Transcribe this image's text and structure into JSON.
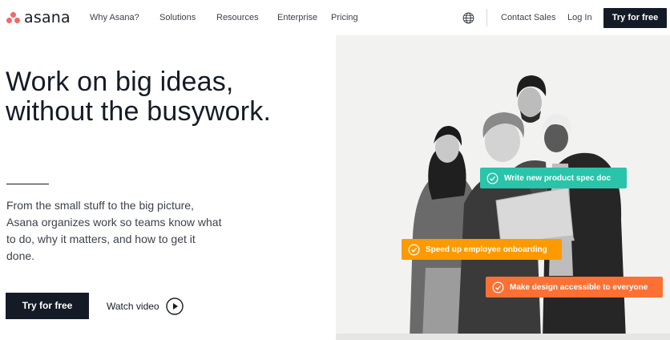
{
  "brand": {
    "name": "asana",
    "logo_color": "#f06a6a"
  },
  "nav": {
    "links": [
      "Why Asana?",
      "Solutions",
      "Resources",
      "Enterprise",
      "Pricing"
    ],
    "globe_icon": "globe-icon",
    "contact_sales": "Contact Sales",
    "log_in": "Log In",
    "cta": "Try for free"
  },
  "hero": {
    "headline_line1": "Work on big ideas,",
    "headline_line2": "without the busywork.",
    "description": "From the small stuff to the big picture, Asana organizes work so teams know what to do, why it matters, and how to get it done.",
    "primary_button": "Try for free",
    "watch_video": "Watch video",
    "play_icon": "play-icon"
  },
  "tasks": [
    {
      "label": "Write new product spec doc",
      "color": "#29c4a9",
      "icon": "check-circle-icon"
    },
    {
      "label": "Speed up employee onboarding",
      "color": "#fd9a00",
      "icon": "check-circle-icon"
    },
    {
      "label": "Make design accessible to everyone",
      "color": "#fc7033",
      "icon": "check-circle-icon"
    }
  ],
  "colors": {
    "dark": "#151b26",
    "photo_bg": "#f2f2f1"
  }
}
